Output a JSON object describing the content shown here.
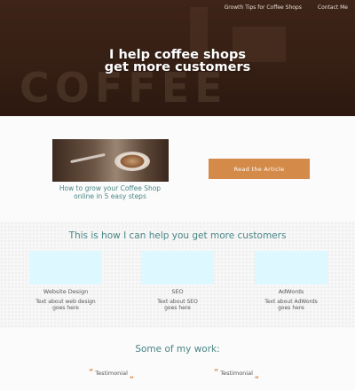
{
  "nav": {
    "links": [
      "Growth Tips for Coffee Shops",
      "Contact Me"
    ]
  },
  "hero": {
    "headline_line1": "I help coffee shops",
    "headline_line2": "get more customers",
    "background_text": "COFFEE"
  },
  "article": {
    "caption_line1": "How to grow your Coffee Shop",
    "caption_line2": "online in 5 easy steps",
    "cta_label": "Read the Article"
  },
  "services": {
    "heading": "This is how I can help you get more customers",
    "items": [
      {
        "title": "Website Design",
        "desc_line1": "Text about web design",
        "desc_line2": "goes here"
      },
      {
        "title": "SEO",
        "desc_line1": "Text about SEO",
        "desc_line2": "goes here"
      },
      {
        "title": "AdWords",
        "desc_line1": "Text about AdWords",
        "desc_line2": "goes here"
      }
    ]
  },
  "work": {
    "heading": "Some of my work:",
    "open_quote": "“",
    "close_quote": "„",
    "testimonials": [
      "Testimonial",
      "Testimonial"
    ]
  },
  "colors": {
    "accent": "#d48a48",
    "teal": "#4a8585",
    "hero_dark": "#3e2418",
    "service_box": "#def8ff"
  }
}
